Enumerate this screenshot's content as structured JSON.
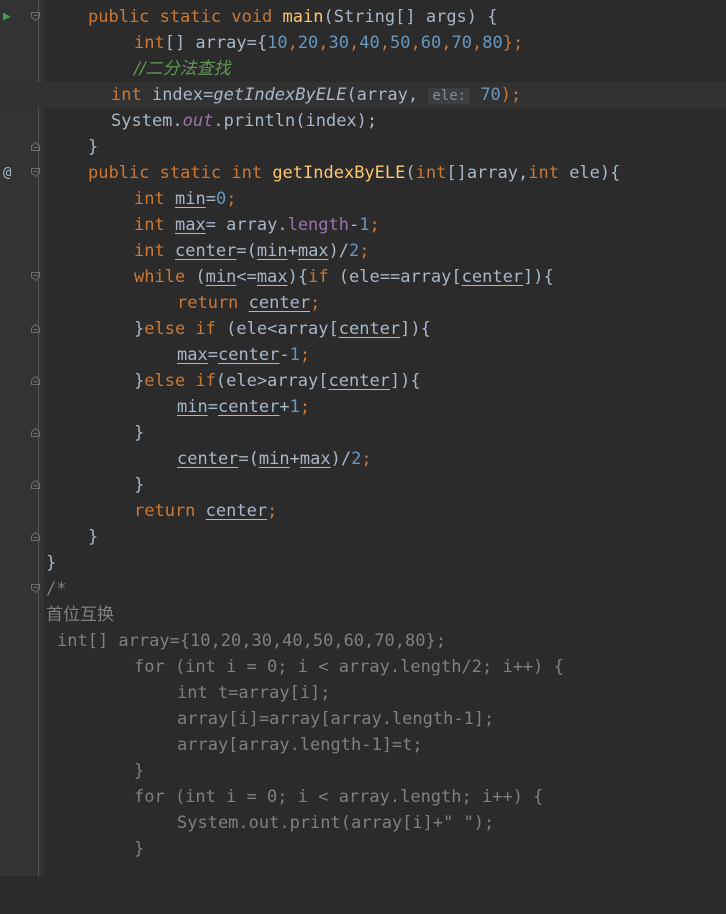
{
  "editor": {
    "line1": {
      "t1": "public",
      "t2": "static",
      "t3": "void",
      "t4": "main",
      "t5": "(String[] args) {"
    },
    "line2": {
      "t1": "int",
      "t2": "[] array={",
      "n1": "10",
      "n2": "20",
      "n3": "30",
      "n4": "40",
      "n5": "50",
      "n6": "60",
      "n7": "70",
      "n8": "80",
      "t3": "};"
    },
    "line3": {
      "comment": "//二分法查找"
    },
    "line4": {
      "t1": "int",
      "t2": " index=",
      "t3": "getIndexByELE",
      "t4": "(array,",
      "hint": "ele:",
      "n1": "70",
      "t5": ");"
    },
    "line5": {
      "t1": "System.",
      "t2": "out",
      "t3": ".println(index);"
    },
    "line6": {
      "t1": "}"
    },
    "line7": {
      "t1": "public",
      "t2": "static",
      "t3": "int",
      "t4": "getIndexByELE",
      "t5": "(",
      "t6": "int",
      "t7": "[]array,",
      "t8": "int",
      "t9": " ele){"
    },
    "line8": {
      "t1": "int",
      "v1": "min",
      "t2": "=",
      "n1": "0",
      "t3": ";"
    },
    "line9": {
      "t1": "int",
      "v1": "max",
      "t2": "= array.",
      "f1": "length",
      "t3": "-",
      "n1": "1",
      "t4": ";"
    },
    "line10": {
      "t1": "int",
      "v1": "center",
      "t2": "=(",
      "v2": "min",
      "t3": "+",
      "v3": "max",
      "t4": ")/",
      "n1": "2",
      "t5": ";"
    },
    "line11": {
      "t1": "while",
      "t2": " (",
      "v1": "min",
      "t3": "<=",
      "v2": "max",
      "t4": "){",
      "t5": "if",
      "t6": " (ele==array[",
      "v3": "center",
      "t7": "]){"
    },
    "line12": {
      "t1": "return",
      "v1": "center",
      "t2": ";"
    },
    "line13": {
      "t1": "}",
      "t2": "else if",
      "t3": " (ele<array[",
      "v1": "center",
      "t4": "]){"
    },
    "line14": {
      "v1": "max",
      "t1": "=",
      "v2": "center",
      "t2": "-",
      "n1": "1",
      "t3": ";"
    },
    "line15": {
      "t1": "}",
      "t2": "else if",
      "t3": "(ele>array[",
      "v1": "center",
      "t4": "]){"
    },
    "line16": {
      "v1": "min",
      "t1": "=",
      "v2": "center",
      "t2": "+",
      "n1": "1",
      "t3": ";"
    },
    "line17": {
      "t1": "}"
    },
    "line18": {
      "v1": "center",
      "t1": "=(",
      "v2": "min",
      "t2": "+",
      "v3": "max",
      "t3": ")/",
      "n1": "2",
      "t4": ";"
    },
    "line19": {
      "t1": "}"
    },
    "line20": {
      "t1": "return",
      "v1": "center",
      "t2": ";"
    },
    "line21": {
      "t1": "}"
    },
    "line22": {
      "t1": "}"
    },
    "line23": {
      "t1": "/*"
    },
    "line24": {
      "t1": "首位互换"
    },
    "line25": {
      "t1": "int[] array={10,20,30,40,50,60,70,80};"
    },
    "line26": {
      "t1": "for (int i = 0; i < array.length/2; i++) {"
    },
    "line27": {
      "t1": "int t=array[i];"
    },
    "line28": {
      "t1": "array[i]=array[array.length-1];"
    },
    "line29": {
      "t1": "array[array.length-1]=t;"
    },
    "line30": {
      "t1": "}"
    },
    "line31": {
      "t1": "for (int i = 0; i < array.length; i++) {"
    },
    "line32": {
      "t1": "System.out.print(array[i]+\" \");"
    },
    "line33": {
      "t1": "}"
    },
    "gutter": {
      "run_icon": "▶",
      "impl_icon": "@"
    }
  }
}
